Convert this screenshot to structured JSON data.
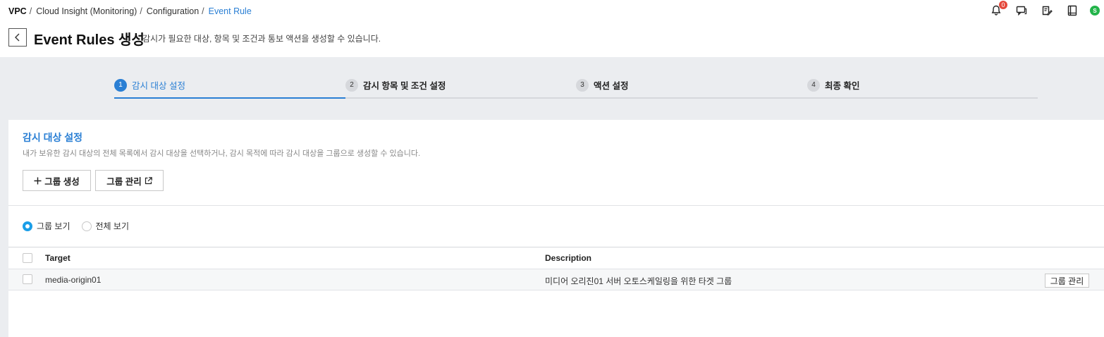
{
  "breadcrumb": {
    "root": "VPC",
    "items": [
      "Cloud Insight (Monitoring)",
      "Configuration"
    ],
    "sep": "/",
    "current": "Event Rule"
  },
  "header_icons": {
    "notification_count": "0",
    "avatar_initial": "S",
    "icons": [
      "bell-icon",
      "chat-icon",
      "edit-note-icon",
      "book-icon",
      "avatar"
    ]
  },
  "page": {
    "title": "Event Rules 생성",
    "description": "감시가 필요한 대상, 항목 및 조건과 통보 액션을 생성할 수 있습니다."
  },
  "steps": [
    {
      "num": "1",
      "label": "감시 대상 설정",
      "active": true
    },
    {
      "num": "2",
      "label": "감시 항목 및 조건 설정",
      "active": false
    },
    {
      "num": "3",
      "label": "액션 설정",
      "active": false
    },
    {
      "num": "4",
      "label": "최종 확인",
      "active": false
    }
  ],
  "section": {
    "title": "감시 대상 설정",
    "description": "내가 보유한 감시 대상의 전체 목록에서 감시 대상을 선택하거나, 감시 목적에 따라 감시 대상을 그룹으로 생성할 수 있습니다.",
    "create_group_label": "그룹 생성",
    "manage_group_label": "그룹 관리"
  },
  "view_options": {
    "group_view": "그룹 보기",
    "all_view": "전체 보기",
    "selected": "group_view"
  },
  "table": {
    "columns": [
      "Target",
      "Description"
    ],
    "rows": [
      {
        "target": "media-origin01",
        "description": "미디어 오리진01 서버 오토스케일링을 위한 타겟 그룹",
        "action": "그룹 관리"
      }
    ]
  },
  "colors": {
    "accent": "#2a7fd4",
    "radio": "#1a9ee8",
    "badge": "#e5483b",
    "avatar": "#23b44a",
    "background": "#ebedf0"
  }
}
